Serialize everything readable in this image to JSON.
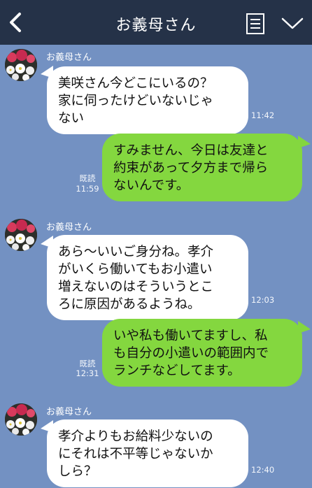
{
  "header": {
    "title": "お義母さん",
    "back_icon": "chevron-left-icon",
    "menu_icon": "list-icon",
    "collapse_icon": "chevron-down-icon"
  },
  "colors": {
    "header_bg": "#253248",
    "chat_bg": "#7391c2",
    "incoming_bubble": "#ffffff",
    "outgoing_bubble": "#84d73f"
  },
  "messages": [
    {
      "side": "left",
      "sender": "お義母さん",
      "text": "美咲さん今どこにいるの？\n家に伺ったけどいないじゃ\nない",
      "time": "11:42"
    },
    {
      "side": "right",
      "read": "既読",
      "text": "すみません、今日は友達と\n約束があって夕方まで帰ら\nないんです。",
      "time": "11:59"
    },
    {
      "side": "left",
      "sender": "お義母さん",
      "text": "あら〜いいご身分ね。孝介\nがいくら働いてもお小遣い\n増えないのはそういうとこ\nろに原因があるようね。",
      "time": "12:03"
    },
    {
      "side": "right",
      "read": "既読",
      "text": "いや私も働いてますし、私\nも自分の小遣いの範囲内で\nランチなどしてます。",
      "time": "12:31"
    },
    {
      "side": "left",
      "sender": "お義母さん",
      "text": "孝介よりもお給料少ないの\nにそれは不平等じゃないか\nしら？",
      "time": "12:40"
    }
  ]
}
